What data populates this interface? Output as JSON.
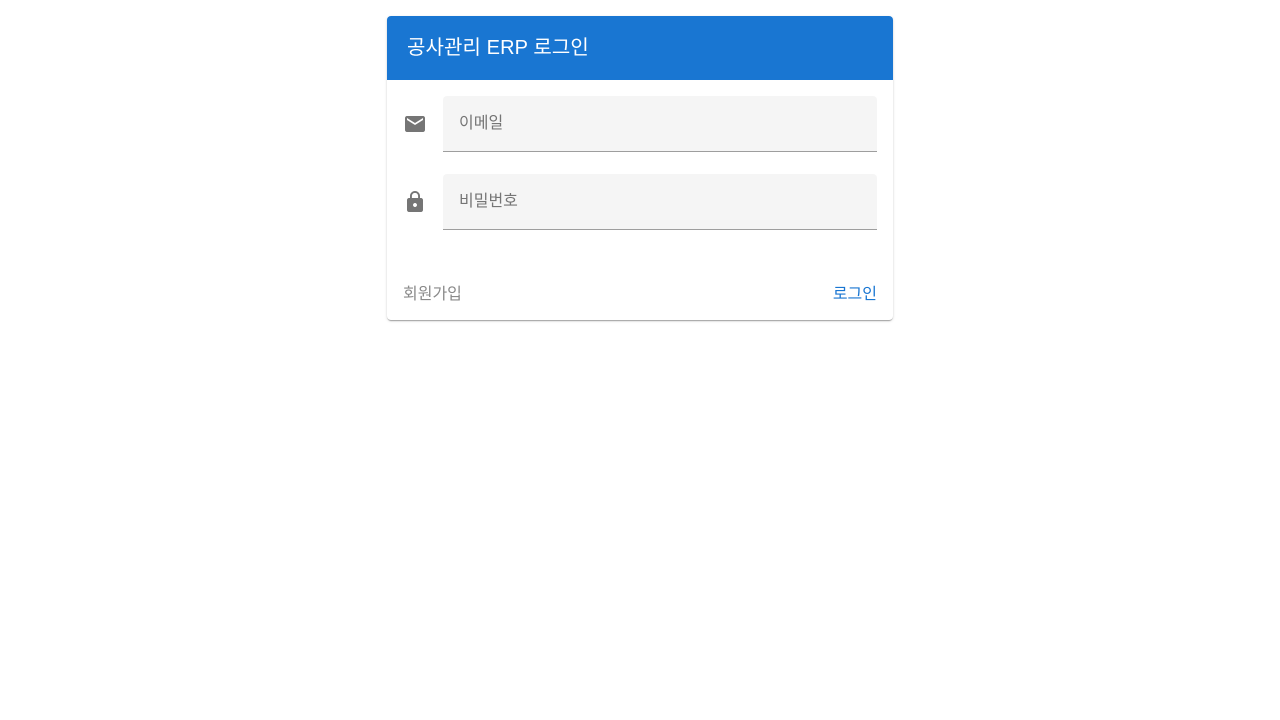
{
  "header": {
    "title": "공사관리 ERP 로그인"
  },
  "form": {
    "email": {
      "icon": "mail-icon",
      "placeholder": "이메일",
      "value": ""
    },
    "password": {
      "icon": "lock-icon",
      "placeholder": "비밀번호",
      "value": ""
    }
  },
  "actions": {
    "signup_label": "회원가입",
    "login_label": "로그인"
  },
  "colors": {
    "primary": "#1976d2",
    "icon": "#757575",
    "field_bg": "#f5f5f5",
    "muted_text": "#8a8a8a"
  }
}
